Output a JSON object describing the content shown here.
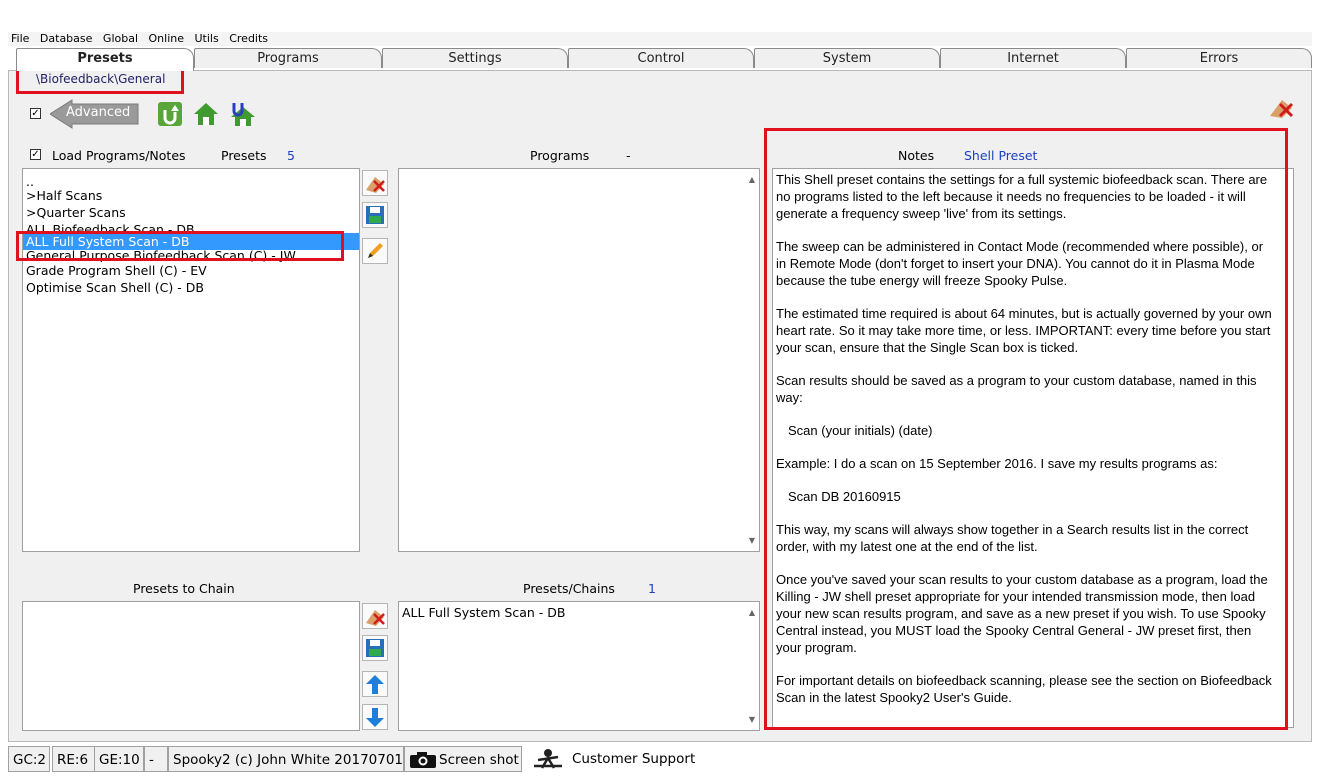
{
  "menu": [
    "File",
    "Database",
    "Global",
    "Online",
    "Utils",
    "Credits"
  ],
  "tabs": [
    "Presets",
    "Programs",
    "Settings",
    "Control",
    "System",
    "Internet",
    "Errors"
  ],
  "preset_path": "\\Biofeedback\\General",
  "toolbar": {
    "advanced_label": "Advanced",
    "advanced_checked": "✓"
  },
  "left": {
    "load_label": "Load Programs/Notes",
    "load_checked": "✓",
    "presets_label": "Presets",
    "presets_count": "5",
    "items": [
      "..",
      ">Half Scans",
      ">Quarter Scans",
      "ALL Biofeedback Scan - DB",
      "ALL Full System Scan - DB",
      "General Purpose Biofeedback Scan (C) - JW",
      "Grade Program Shell (C) - EV",
      "Optimise Scan Shell (C) - DB"
    ],
    "selected_item": "ALL Full System Scan - DB"
  },
  "programs": {
    "label": "Programs",
    "count": "-"
  },
  "notes": {
    "label": "Notes",
    "preset_name": "Shell Preset",
    "paragraphs": [
      "This Shell preset contains the settings for a full systemic biofeedback scan. There are no programs listed to the left because it needs no frequencies to be loaded - it will generate a frequency sweep 'live' from its settings.",
      "The sweep can be administered in Contact Mode (recommended where possible), or in Remote Mode (don't forget to insert your DNA). You cannot do it in Plasma Mode because the tube energy will freeze Spooky Pulse.",
      "The estimated time required is about 64 minutes, but is actually governed by your own heart rate. So it may take more time, or less. IMPORTANT: every time before you start your scan, ensure that the Single Scan box is ticked.",
      "Scan results should be saved as a program to your custom database, named in this way:",
      "Scan (your initials) (date)",
      "Example: I do a scan on 15 September 2016. I save my results programs as:",
      "Scan DB 20160915",
      "This way, my scans will always show together in a Search results list in the correct order, with my latest one at the end of the list.",
      "Once you've saved your scan results to your custom database as a program, load the Killing - JW shell preset appropriate for your intended transmission mode, then load your new scan results program, and save as a new preset if you wish. To use Spooky Central instead, you MUST load the Spooky Central General - JW preset first, then your program.",
      "For important details on biofeedback scanning, please see the section on Biofeedback Scan in the latest Spooky2 User's Guide."
    ]
  },
  "chain": {
    "presets_to_chain_label": "Presets to Chain",
    "presets_chains_label": "Presets/Chains",
    "presets_chains_count": "1",
    "chain_items": [
      "ALL Full System Scan - DB"
    ]
  },
  "status": {
    "gc": "GC:2",
    "re": "RE:6",
    "ge": "GE:10",
    "dash": "-",
    "copyright": "Spooky2 (c) John White 20170701",
    "screenshot": "Screen shot",
    "support": "Customer Support"
  },
  "colors": {
    "highlight": "#e0101e",
    "selection": "#3399ff",
    "accent_blue": "#1c3fbf"
  }
}
